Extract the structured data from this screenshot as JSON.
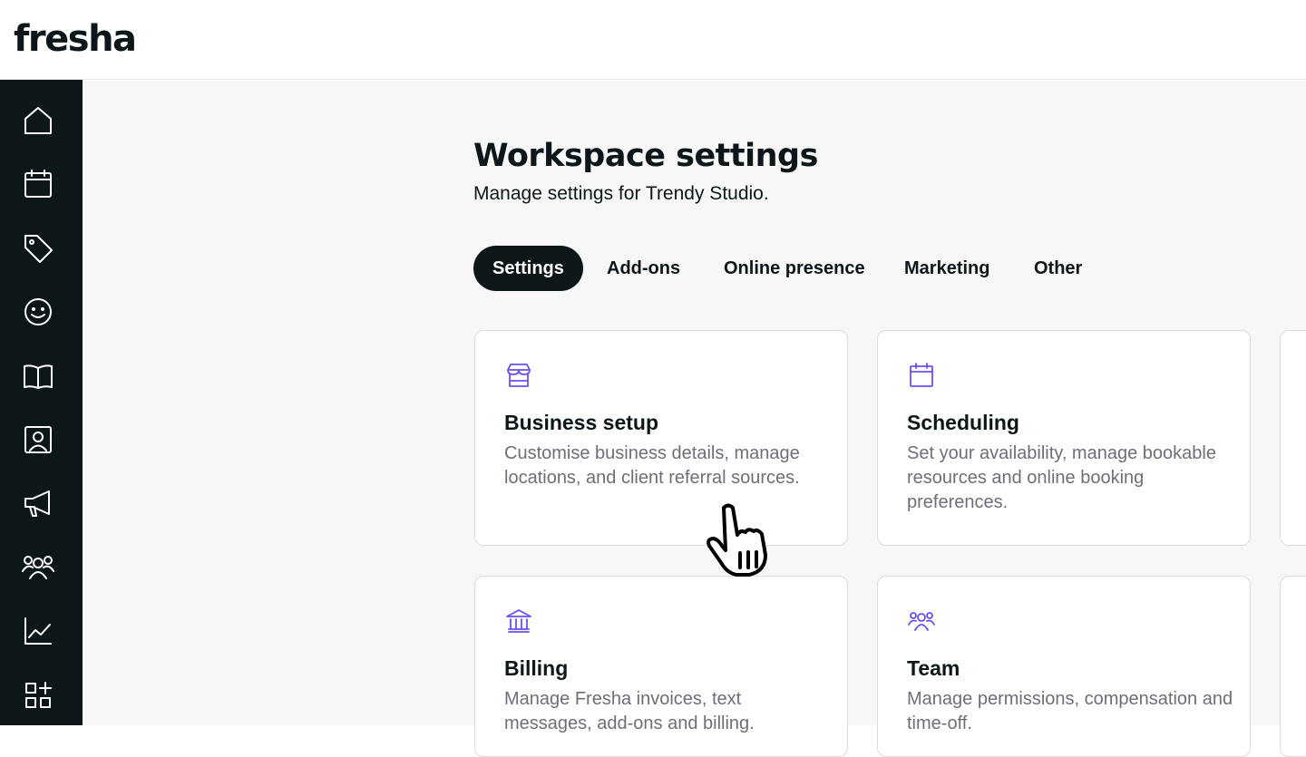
{
  "app": {
    "logo": "fresha"
  },
  "sidebar": {
    "items": [
      {
        "icon": "home-icon"
      },
      {
        "icon": "calendar-icon"
      },
      {
        "icon": "tag-icon"
      },
      {
        "icon": "smiley-icon"
      },
      {
        "icon": "book-icon"
      },
      {
        "icon": "contact-card-icon"
      },
      {
        "icon": "megaphone-icon"
      },
      {
        "icon": "team-icon"
      },
      {
        "icon": "chart-icon"
      },
      {
        "icon": "apps-icon"
      }
    ]
  },
  "header": {
    "title": "Workspace settings",
    "subtitle": "Manage settings for Trendy Studio."
  },
  "tabs": [
    {
      "label": "Settings",
      "active": true
    },
    {
      "label": "Add-ons",
      "active": false
    },
    {
      "label": "Online presence",
      "active": false
    },
    {
      "label": "Marketing",
      "active": false
    },
    {
      "label": "Other",
      "active": false
    }
  ],
  "cards": [
    {
      "icon": "store-icon",
      "title": "Business setup",
      "description": "Customise business details, manage locations, and client referral sources."
    },
    {
      "icon": "calendar-icon",
      "title": "Scheduling",
      "description": "Set your availability, manage bookable resources and online booking preferences."
    },
    {
      "icon": "bank-icon",
      "title": "Billing",
      "description": "Manage Fresha invoices, text messages, add-ons and billing."
    },
    {
      "icon": "team-icon",
      "title": "Team",
      "description": "Manage permissions, compensation and time-off."
    }
  ],
  "colors": {
    "sidebar": "#0d1619",
    "accent": "#6950f3",
    "text": "#0d1619",
    "muted": "#6e6e78"
  }
}
